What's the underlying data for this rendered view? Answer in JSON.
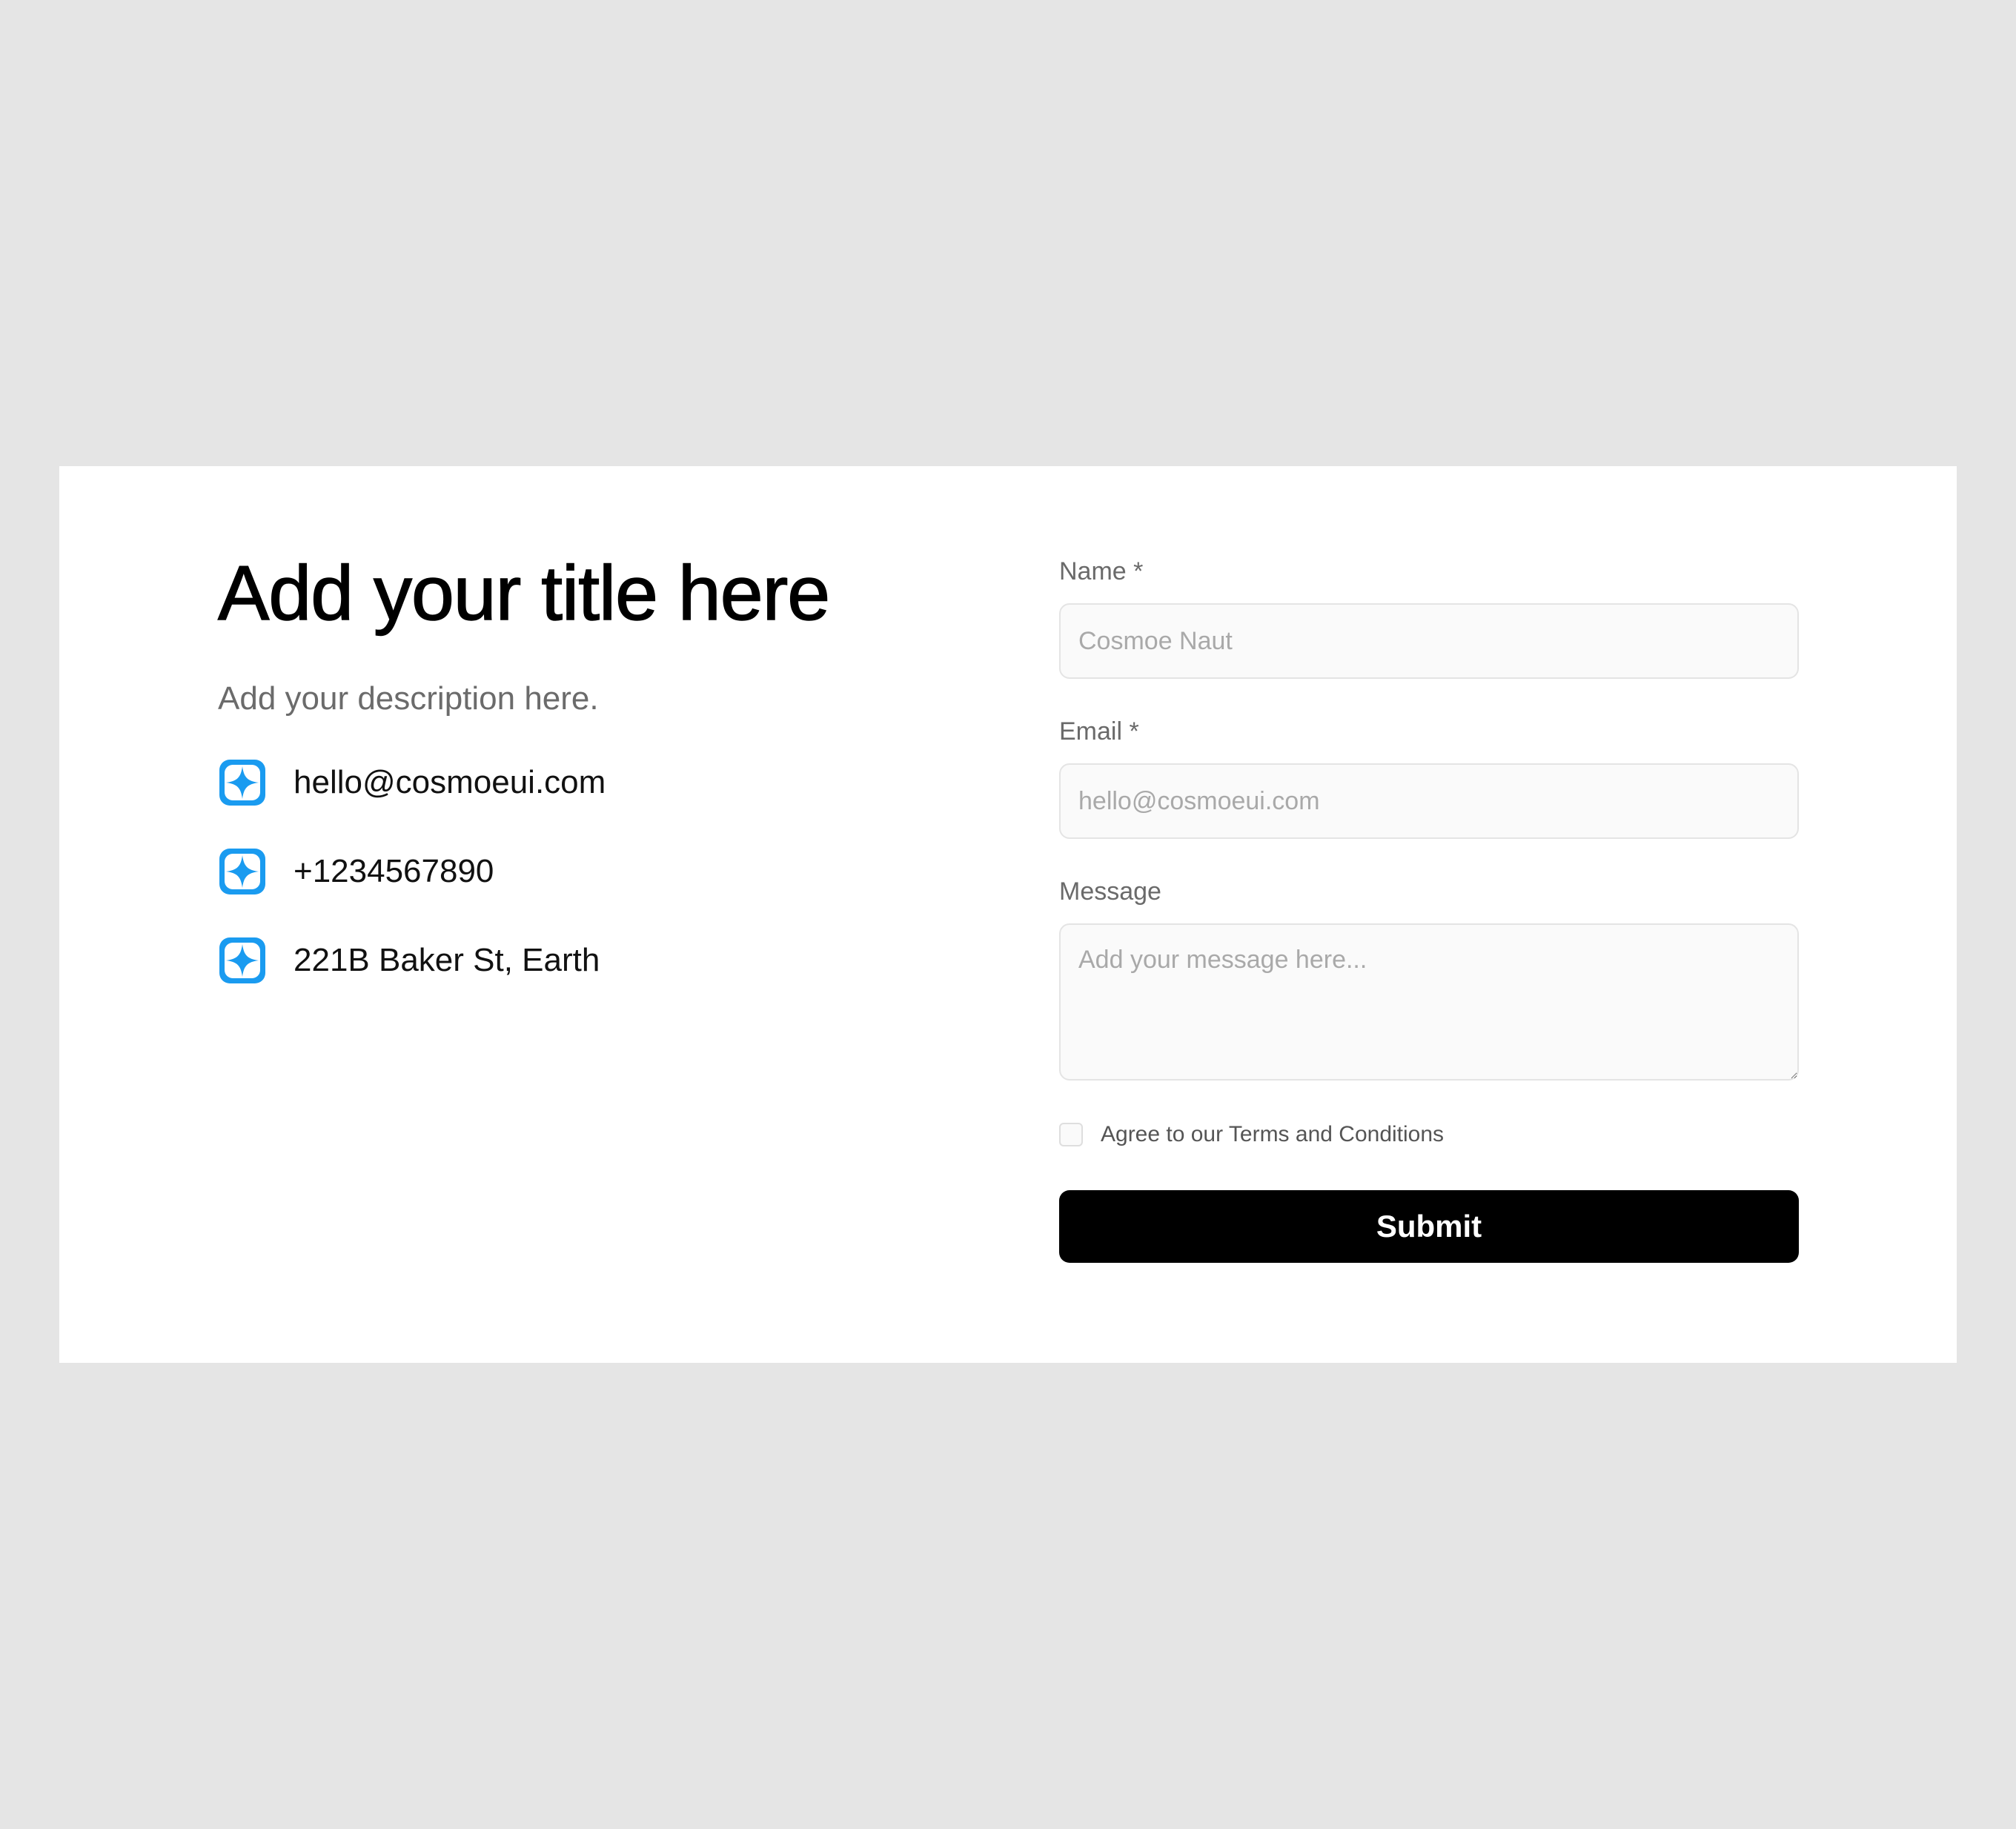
{
  "hero": {
    "title": "Add your title here",
    "description": "Add your description here."
  },
  "contacts": [
    {
      "icon": "sparkle-icon",
      "text": "hello@cosmoeui.com"
    },
    {
      "icon": "sparkle-icon",
      "text": "+1234567890"
    },
    {
      "icon": "sparkle-icon",
      "text": "221B Baker St, Earth"
    }
  ],
  "form": {
    "name": {
      "label": "Name *",
      "placeholder": "Cosmoe Naut",
      "value": ""
    },
    "email": {
      "label": "Email *",
      "placeholder": "hello@cosmoeui.com",
      "value": ""
    },
    "message": {
      "label": "Message",
      "placeholder": "Add your message here...",
      "value": ""
    },
    "terms": {
      "label": "Agree to our Terms and Conditions",
      "checked": false
    },
    "submit_label": "Submit"
  },
  "colors": {
    "background": "#e5e5e5",
    "card": "#ffffff",
    "accent_icon": "#1a9bf0",
    "button": "#000000"
  }
}
